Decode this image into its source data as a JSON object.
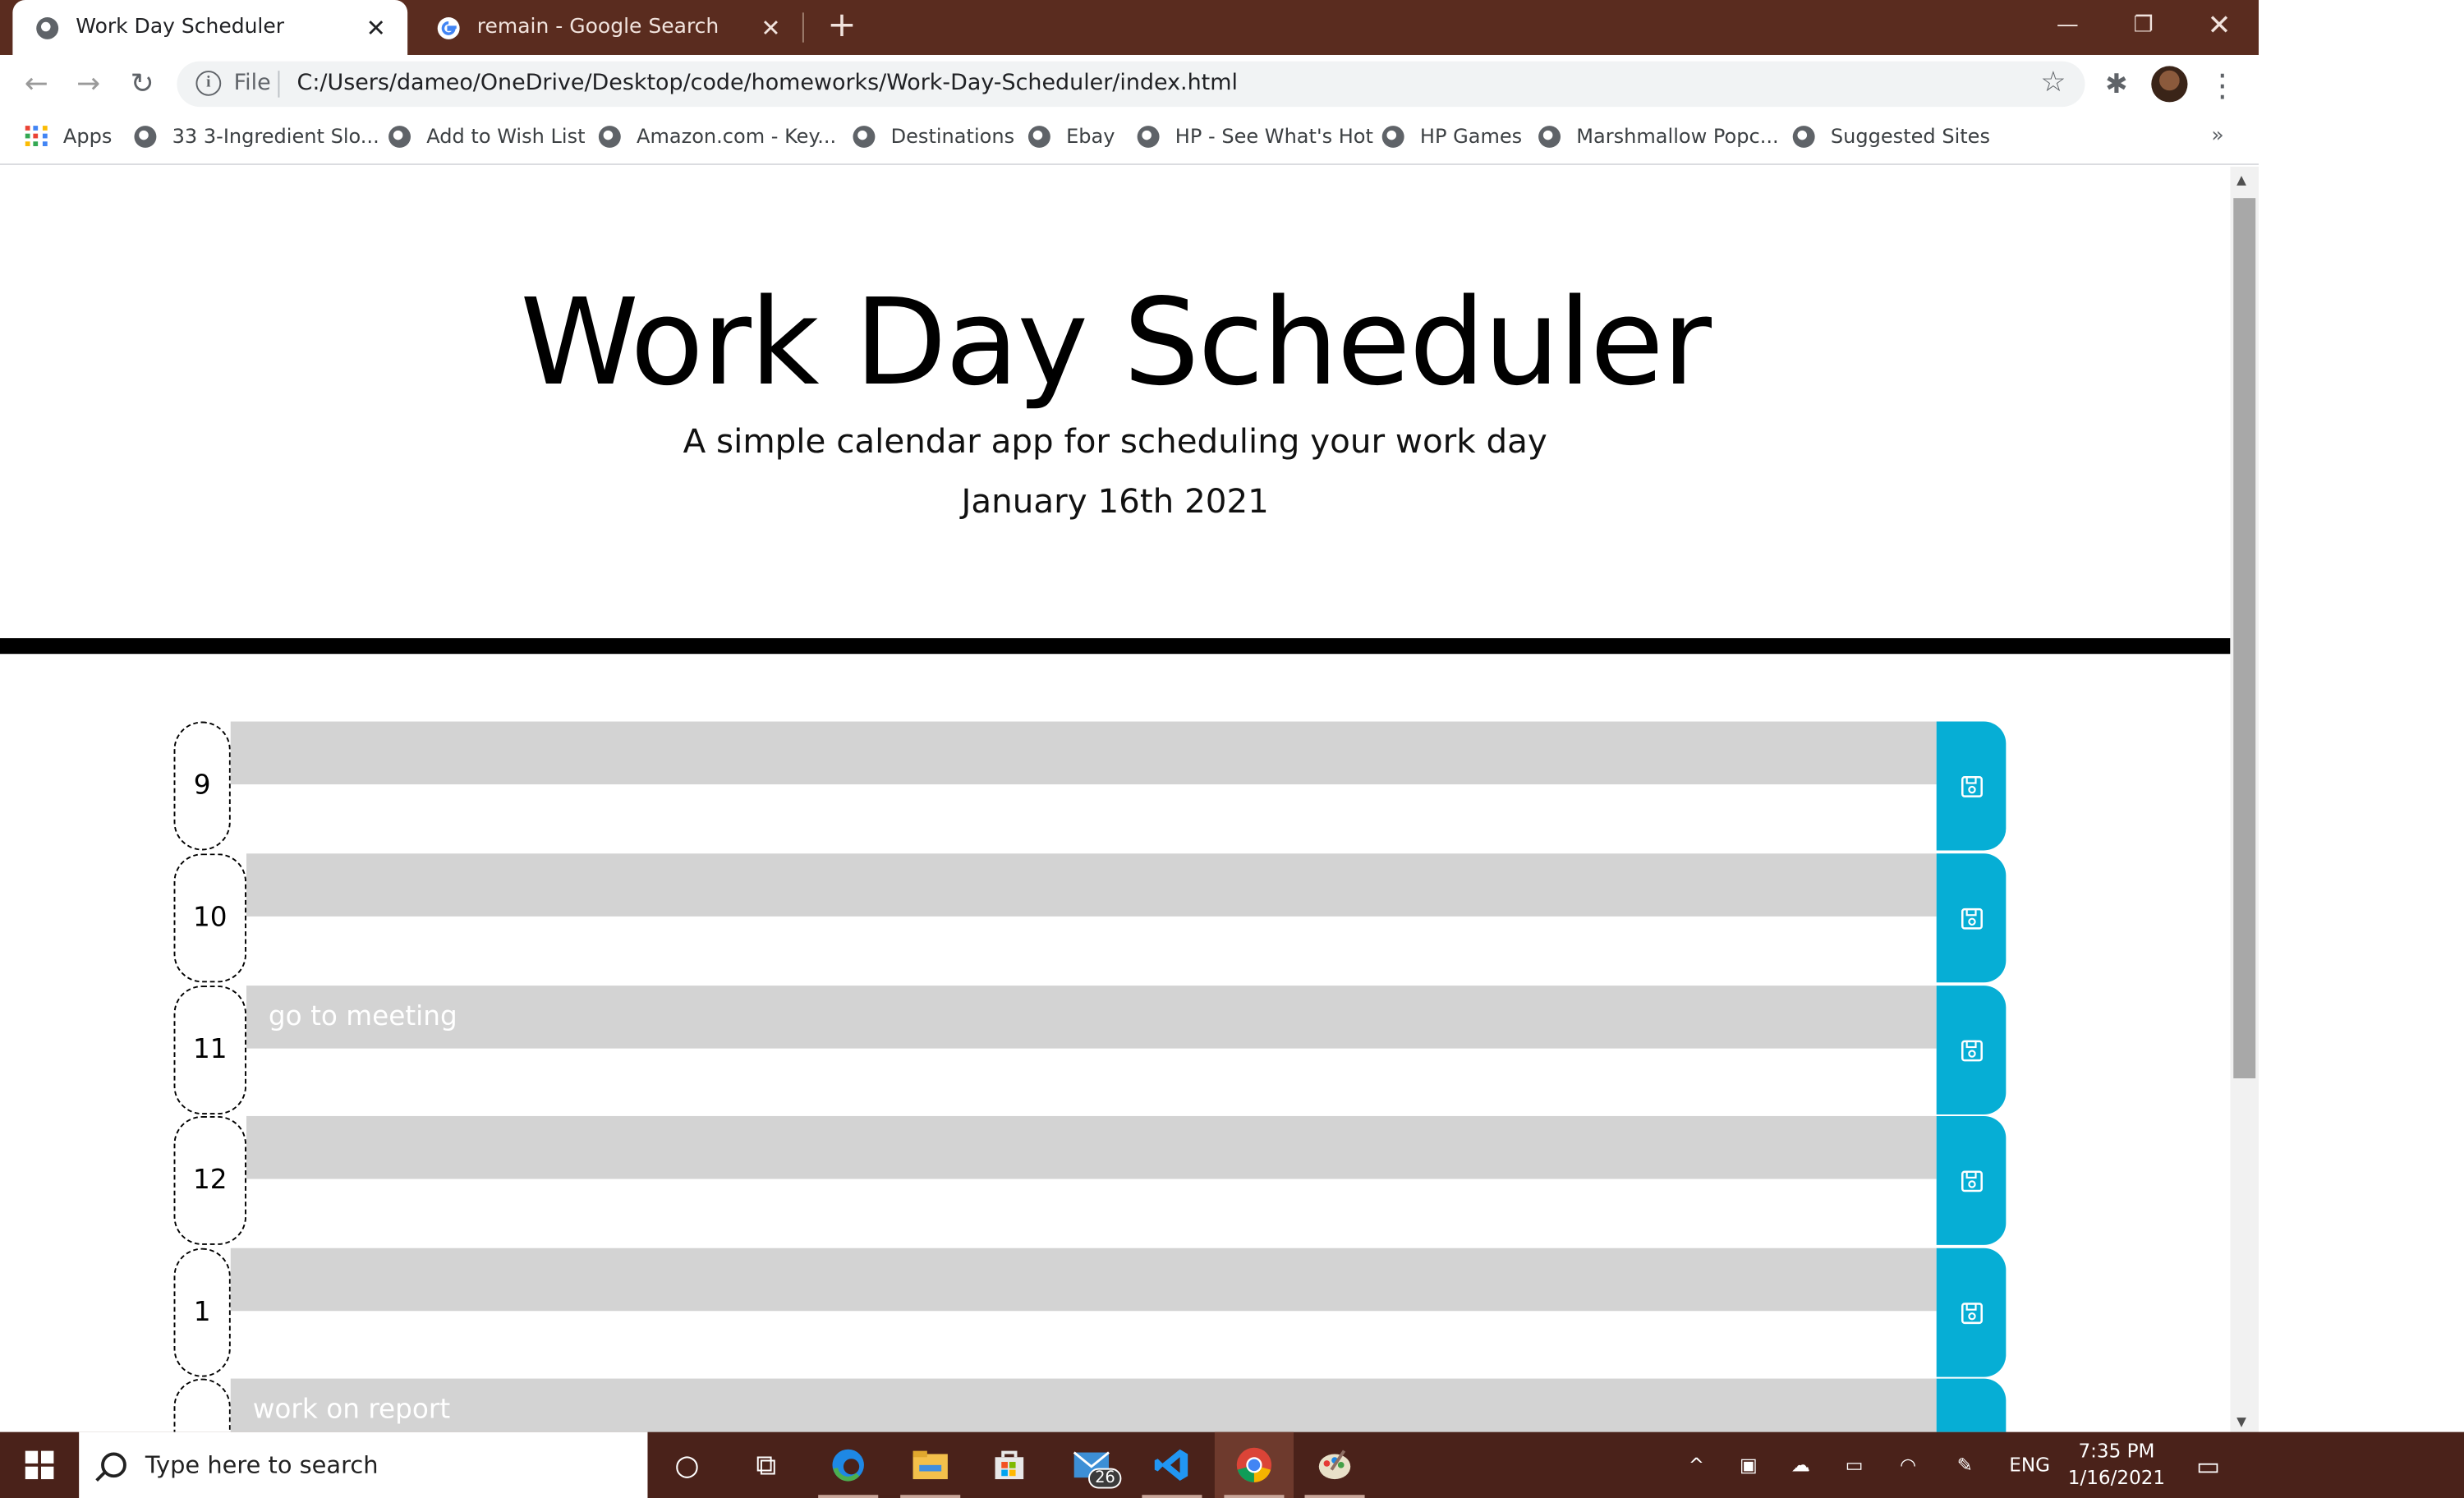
{
  "browser": {
    "tabs": [
      {
        "title": "Work Day Scheduler",
        "active": true
      },
      {
        "title": "remain - Google Search",
        "active": false
      }
    ],
    "omnibox": {
      "scheme": "File",
      "url": "C:/Users/dameo/OneDrive/Desktop/code/homeworks/Work-Day-Scheduler/index.html"
    },
    "bookmarks": [
      "Apps",
      "33 3-Ingredient Slo...",
      "Add to Wish List",
      "Amazon.com - Key...",
      "Destinations",
      "Ebay",
      "HP - See What's Hot",
      "HP Games",
      "Marshmallow Popc...",
      "Suggested Sites"
    ],
    "bookmarks_more": "»"
  },
  "page": {
    "title": "Work Day Scheduler",
    "lead": "A simple calendar app for scheduling your work day",
    "date": "January 16th 2021",
    "rows": [
      {
        "hour": "9",
        "text": ""
      },
      {
        "hour": "10",
        "text": ""
      },
      {
        "hour": "11",
        "text": "go to meeting"
      },
      {
        "hour": "12",
        "text": ""
      },
      {
        "hour": "1",
        "text": ""
      },
      {
        "hour": "",
        "text": "work on report"
      }
    ],
    "accent_color": "#06aed5",
    "row_color": "#d3d3d3"
  },
  "taskbar": {
    "search_placeholder": "Type here to search",
    "mail_badge": "26",
    "language": "ENG",
    "time": "7:35 PM",
    "date": "1/16/2021"
  }
}
